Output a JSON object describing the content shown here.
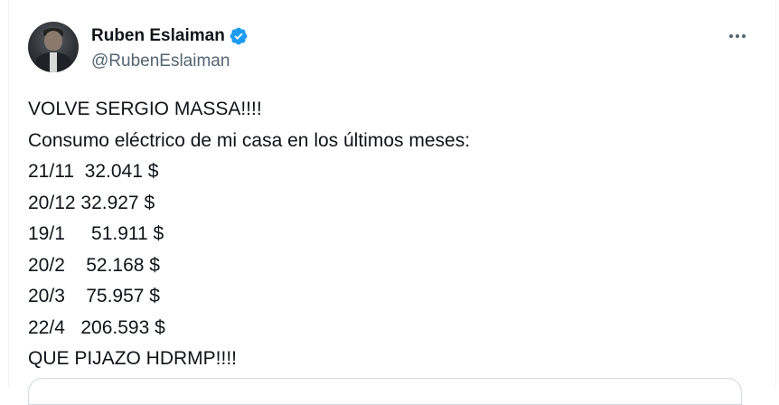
{
  "author": {
    "display_name": "Ruben Eslaiman",
    "handle": "@RubenEslaiman",
    "verified": true,
    "verified_color": "#1d9bf0"
  },
  "tweet": {
    "lines": [
      "VOLVE SERGIO MASSA!!!!",
      "Consumo eléctrico de mi casa en los últimos meses:",
      "21/11  32.041 $",
      "20/12 32.927 $",
      "19/1     51.911 $",
      "20/2    52.168 $",
      "20/3    75.957 $",
      "22/4   206.593 $",
      "QUE PIJAZO HDRMP!!!!"
    ]
  },
  "icons": {
    "more": "more-options-icon",
    "verified": "verified-badge-icon"
  }
}
